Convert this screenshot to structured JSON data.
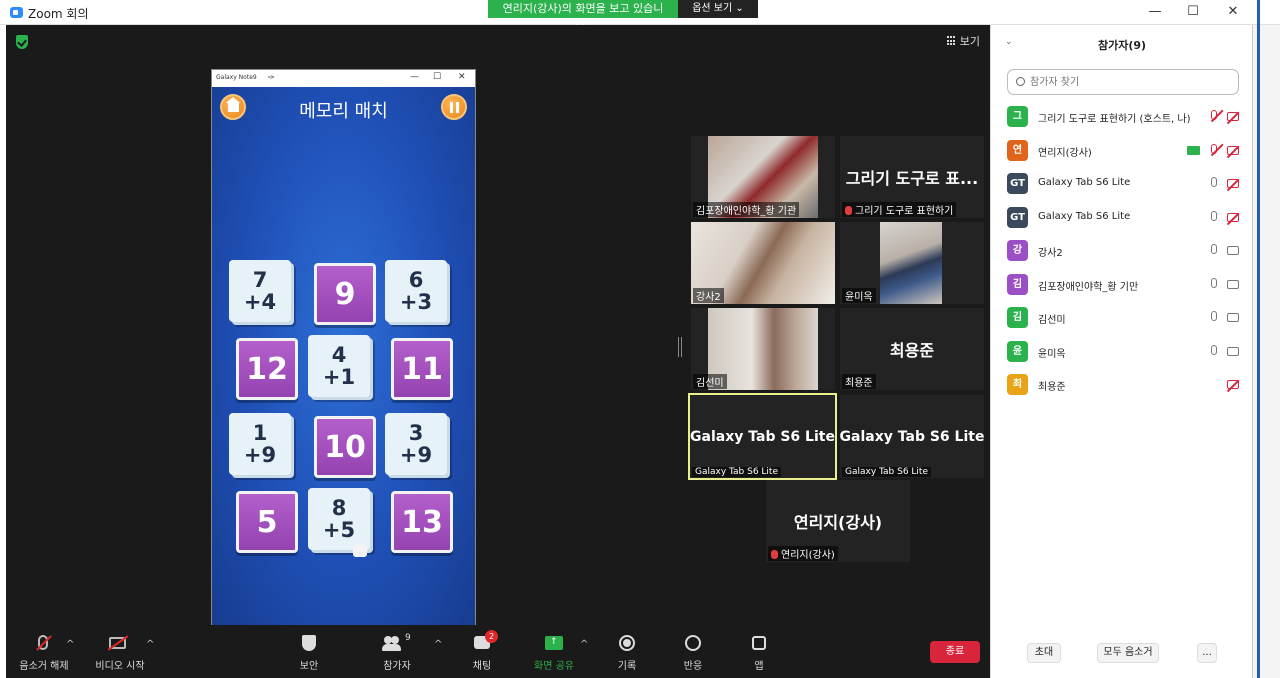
{
  "window": {
    "title": "Zoom 회의"
  },
  "banner": {
    "viewing_text": "연리지(강사)의 화면을 보고 있습니다.",
    "view_options": "옵션 보기"
  },
  "stage": {
    "view_label": "보기"
  },
  "shared_window": {
    "title": "Galaxy Note9",
    "game_title": "메모리 매치",
    "cards": [
      {
        "type": "light",
        "lines": [
          "7",
          "+4"
        ]
      },
      {
        "type": "purple",
        "lines": [
          "9"
        ]
      },
      {
        "type": "light",
        "lines": [
          "6",
          "+3"
        ]
      },
      {
        "type": "purple",
        "lines": [
          "12"
        ]
      },
      {
        "type": "light",
        "lines": [
          "4",
          "+1"
        ]
      },
      {
        "type": "purple",
        "lines": [
          "11"
        ]
      },
      {
        "type": "light",
        "lines": [
          "1",
          "+9"
        ]
      },
      {
        "type": "purple",
        "lines": [
          "10"
        ]
      },
      {
        "type": "light",
        "lines": [
          "3",
          "+9"
        ]
      },
      {
        "type": "purple",
        "lines": [
          "5"
        ]
      },
      {
        "type": "light",
        "lines": [
          "8",
          "+5"
        ]
      },
      {
        "type": "purple",
        "lines": [
          "13"
        ]
      }
    ]
  },
  "tiles": [
    {
      "name": "김포장애인야학_황 기관",
      "label": "",
      "video": true,
      "muted": false
    },
    {
      "name": "그리기 도구로 표현하기",
      "label": "그리기 도구로 표...",
      "video": false,
      "muted": true
    },
    {
      "name": "강사2",
      "label": "",
      "video": true,
      "muted": false
    },
    {
      "name": "윤미옥",
      "label": "",
      "video": true,
      "muted": false
    },
    {
      "name": "김선미",
      "label": "",
      "video": true,
      "muted": false
    },
    {
      "name": "최용준",
      "label": "최용준",
      "video": false,
      "muted": false
    },
    {
      "name": "Galaxy Tab S6 Lite",
      "label": "Galaxy Tab S6 Lite",
      "video": false,
      "muted": false
    },
    {
      "name": "Galaxy Tab S6 Lite",
      "label": "Galaxy Tab S6 Lite",
      "video": false,
      "muted": false
    },
    {
      "name": "연리지(강사)",
      "label": "연리지(강사)",
      "video": false,
      "muted": true
    }
  ],
  "toolbar": {
    "unmute": "음소거 해제",
    "start_video": "비디오 시작",
    "security": "보안",
    "participants": "참가자",
    "participants_count": "9",
    "chat": "채팅",
    "chat_badge": "2",
    "share_screen": "화면 공유",
    "record": "기록",
    "reactions": "반응",
    "apps": "앱",
    "end": "종료"
  },
  "panel": {
    "title": "참가자(9)",
    "search_placeholder": "참가자 찾기",
    "participants": [
      {
        "initial": "그",
        "color": "#2bb24c",
        "name": "그리기 도구로 표현하기 (호스트, 나)",
        "mic": "off",
        "cam": "off",
        "sharing": false
      },
      {
        "initial": "연",
        "color": "#e0641b",
        "name": "연리지(강사)",
        "mic": "off",
        "cam": "off",
        "sharing": true
      },
      {
        "initial": "GT",
        "color": "#3a4a5c",
        "name": "Galaxy Tab S6 Lite",
        "mic": "on",
        "cam": "off",
        "sharing": false
      },
      {
        "initial": "GT",
        "color": "#3a4a5c",
        "name": "Galaxy Tab S6 Lite",
        "mic": "on",
        "cam": "off",
        "sharing": false
      },
      {
        "initial": "강",
        "color": "#9b4fc4",
        "name": "강사2",
        "mic": "on",
        "cam": "on",
        "sharing": false
      },
      {
        "initial": "김",
        "color": "#9b4fc4",
        "name": "김포장애인야학_황 기만",
        "mic": "on",
        "cam": "on",
        "sharing": false
      },
      {
        "initial": "김",
        "color": "#2bb24c",
        "name": "김선미",
        "mic": "on",
        "cam": "on",
        "sharing": false
      },
      {
        "initial": "윤",
        "color": "#2bb24c",
        "name": "윤미옥",
        "mic": "on",
        "cam": "on",
        "sharing": false
      },
      {
        "initial": "최",
        "color": "#e8a317",
        "name": "최용준",
        "mic": "none",
        "cam": "off",
        "sharing": false
      }
    ],
    "invite": "초대",
    "mute_all": "모두 음소거",
    "more": "..."
  }
}
